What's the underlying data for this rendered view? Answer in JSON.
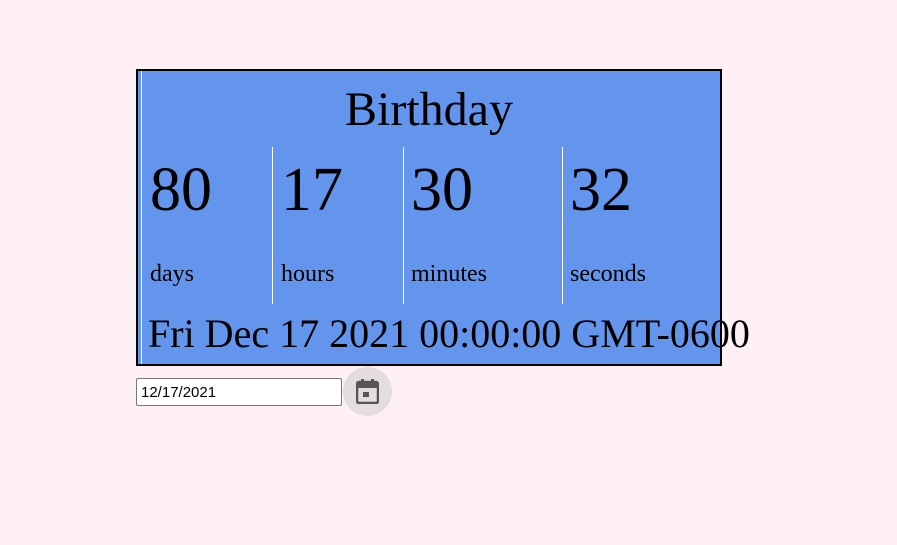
{
  "countdown": {
    "title": "Birthday",
    "units": [
      {
        "value": "80",
        "label": "days"
      },
      {
        "value": "17",
        "label": "hours"
      },
      {
        "value": "30",
        "label": "minutes"
      },
      {
        "value": "32",
        "label": "seconds"
      }
    ],
    "target_date_text": "Fri Dec 17 2021 00:00:00 GMT-0600"
  },
  "date_input": {
    "value": "12/17/2021",
    "picker_icon": "calendar-icon"
  },
  "colors": {
    "page_background": "#fff0f5",
    "box_background": "#6495ed",
    "box_border": "#000000",
    "divider": "#ffffff",
    "picker_background": "#e3dde0",
    "picker_icon": "#555555"
  }
}
